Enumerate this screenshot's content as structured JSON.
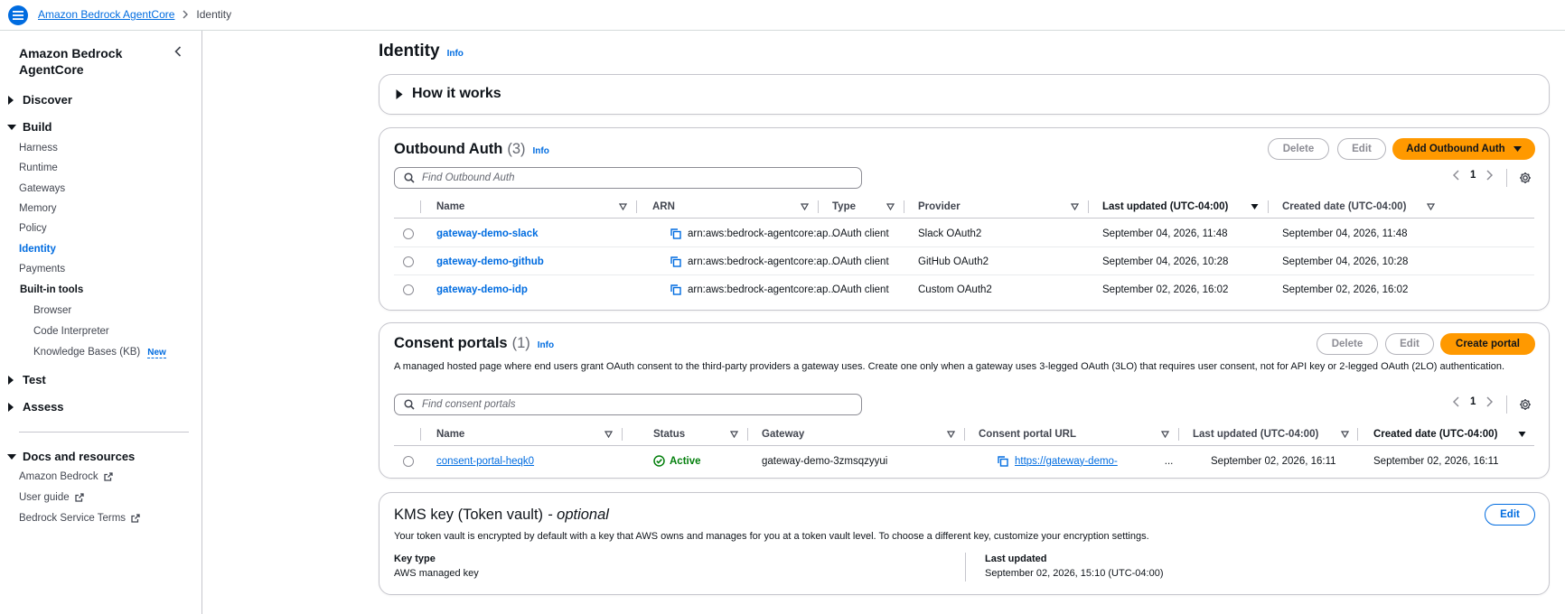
{
  "topbar": {
    "breadcrumbs": [
      "Amazon Bedrock AgentCore",
      "Identity"
    ]
  },
  "sidebar": {
    "title": "Amazon Bedrock AgentCore",
    "sections": {
      "discover": "Discover",
      "build": "Build",
      "test": "Test",
      "assess": "Assess",
      "docs": "Docs and resources"
    },
    "build_items": [
      "Harness",
      "Runtime",
      "Gateways",
      "Memory",
      "Policy",
      "Identity",
      "Payments"
    ],
    "active_item": "Identity",
    "builtin_tools_label": "Built-in tools",
    "builtin_tools": [
      "Browser",
      "Code Interpreter",
      "Knowledge Bases (KB)"
    ],
    "new_badge": "New",
    "docs_items": [
      "Amazon Bedrock",
      "User guide",
      "Bedrock Service Terms"
    ]
  },
  "page": {
    "title": "Identity",
    "info_label": "Info"
  },
  "how_it_works": {
    "label": "How it works"
  },
  "outbound_auth": {
    "title": "Outbound Auth",
    "count": "(3)",
    "info_label": "Info",
    "delete_label": "Delete",
    "edit_label": "Edit",
    "add_label": "Add Outbound Auth",
    "search_placeholder": "Find Outbound Auth",
    "page_number": "1",
    "columns": [
      "Name",
      "ARN",
      "Type",
      "Provider",
      "Last updated (UTC-04:00)",
      "Created date (UTC-04:00)"
    ],
    "rows": [
      {
        "name": "gateway-demo-slack",
        "arn": "arn:aws:bedrock-agentcore:ap...",
        "type": "OAuth client",
        "provider": "Slack OAuth2",
        "last_updated": "September 04, 2026, 11:48",
        "created": "September 04, 2026, 11:48"
      },
      {
        "name": "gateway-demo-github",
        "arn": "arn:aws:bedrock-agentcore:ap...",
        "type": "OAuth client",
        "provider": "GitHub OAuth2",
        "last_updated": "September 04, 2026, 10:28",
        "created": "September 04, 2026, 10:28"
      },
      {
        "name": "gateway-demo-idp",
        "arn": "arn:aws:bedrock-agentcore:ap...",
        "type": "OAuth client",
        "provider": "Custom OAuth2",
        "last_updated": "September 02, 2026, 16:02",
        "created": "September 02, 2026, 16:02"
      }
    ]
  },
  "consent_portals": {
    "title": "Consent portals",
    "count": "(1)",
    "info_label": "Info",
    "delete_label": "Delete",
    "edit_label": "Edit",
    "create_label": "Create portal",
    "description": "A managed hosted page where end users grant OAuth consent to the third-party providers a gateway uses. Create one only when a gateway uses 3-legged OAuth (3LO) that requires user consent, not for API key or 2-legged OAuth (2LO) authentication.",
    "search_placeholder": "Find consent portals",
    "page_number": "1",
    "columns": [
      "Name",
      "Status",
      "Gateway",
      "Consent portal URL",
      "Last updated (UTC-04:00)",
      "Created date (UTC-04:00)"
    ],
    "rows": [
      {
        "name": "consent-portal-heqk0",
        "status": "Active",
        "gateway": "gateway-demo-3zmsqzyyui",
        "url": "https://gateway-demo-",
        "url_suffix": "...",
        "last_updated": "September 02, 2026, 16:11",
        "created": "September 02, 2026, 16:11"
      }
    ]
  },
  "kms": {
    "title": "KMS key (Token vault)",
    "optional": "- optional",
    "edit_label": "Edit",
    "description": "Your token vault is encrypted by default with a key that AWS owns and manages for you at a token vault level. To choose a different key, customize your encryption settings.",
    "key_type_label": "Key type",
    "key_type_value": "AWS managed key",
    "last_updated_label": "Last updated",
    "last_updated_value": "September 02, 2026, 15:10 (UTC-04:00)"
  },
  "colors": {
    "link": "#006ce0",
    "primary": "#ff9900",
    "success": "#037f0c",
    "border": "#c6c6cd"
  }
}
